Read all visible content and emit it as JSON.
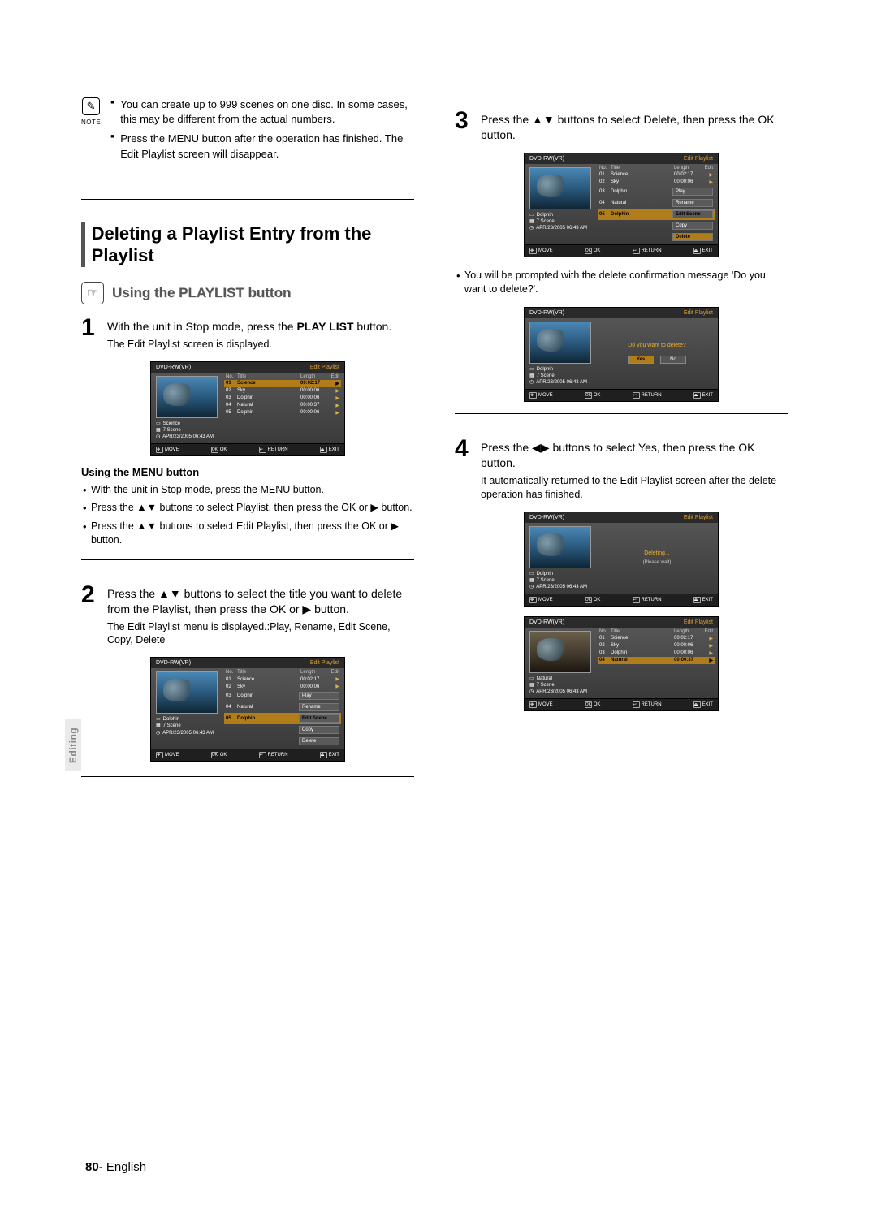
{
  "side_tab": "Editing",
  "page_number": "80",
  "page_lang": "English",
  "note": {
    "icon_glyph": "✎",
    "label": "NOTE",
    "items": [
      "You can create up to 999 scenes on one disc. In some cases, this may be different from the actual numbers.",
      "Press the MENU button after the operation has finished. The Edit Playlist screen will disappear."
    ]
  },
  "section_title": "Deleting a Playlist Entry from the Playlist",
  "subhead": "Using the PLAYLIST button",
  "steps": {
    "s1": {
      "num": "1",
      "main_a": "With the unit in Stop mode, press the ",
      "main_b": "PLAY LIST",
      "main_c": " button.",
      "sub": "The Edit Playlist screen is displayed."
    },
    "s2": {
      "num": "2",
      "main": "Press the ▲▼ buttons to select the title you want to delete from the Playlist, then press the OK or ▶ button.",
      "sub": "The Edit Playlist menu is displayed.:Play, Rename, Edit Scene, Copy, Delete"
    },
    "s3": {
      "num": "3",
      "main": "Press the ▲▼ buttons to select Delete, then press the OK button."
    },
    "s4": {
      "num": "4",
      "main": "Press the ◀▶ buttons to select Yes, then press the OK button.",
      "sub": "It automatically returned to the Edit Playlist screen after the delete operation has finished."
    }
  },
  "menu_alt": {
    "head": "Using the MENU button",
    "items": [
      "With the unit in Stop mode, press the MENU button.",
      "Press the ▲▼ buttons to select Playlist, then press the OK or ▶ button.",
      "Press the ▲▼ buttons to select Edit Playlist, then press the OK or ▶ button."
    ]
  },
  "confirm_bullet": "You will be prompted with the delete confirmation message 'Do you want to delete?'.",
  "osd_common": {
    "disc": "DVD-RW(VR)",
    "mode": "Edit Playlist",
    "cols": {
      "no": "No.",
      "title": "Title",
      "length": "Length",
      "edit": "Edit"
    },
    "foot": {
      "move": "MOVE",
      "ok": "OK",
      "return": "RETURN",
      "exit": "EXIT"
    },
    "scenes": "7 Scene",
    "timestamp": "APR/23/2005 06:43 AM"
  },
  "osd1": {
    "current": "Science",
    "rows": [
      {
        "no": "01",
        "title": "Science",
        "len": "00:02:17",
        "sel": true
      },
      {
        "no": "02",
        "title": "Sky",
        "len": "00:00:06"
      },
      {
        "no": "03",
        "title": "Dolphin",
        "len": "00:00:06"
      },
      {
        "no": "04",
        "title": "Natural",
        "len": "00:00:37"
      },
      {
        "no": "05",
        "title": "Dolphin",
        "len": "00:00:06"
      }
    ]
  },
  "osd2": {
    "current": "Dolphin",
    "rows": [
      {
        "no": "01",
        "title": "Science",
        "len": "00:02:17"
      },
      {
        "no": "02",
        "title": "Sky",
        "len": "00:00:06"
      },
      {
        "no": "03",
        "title": "Dolphin",
        "menu": "Play"
      },
      {
        "no": "04",
        "title": "Natural",
        "menu": "Rename"
      },
      {
        "no": "05",
        "title": "Dolphin",
        "menu": "Edit Scene",
        "sel": true
      }
    ],
    "extra_menu": [
      "Copy",
      "Delete"
    ]
  },
  "osd3": {
    "current": "Dolphin",
    "rows": [
      {
        "no": "01",
        "title": "Science",
        "len": "00:02:17"
      },
      {
        "no": "02",
        "title": "Sky",
        "len": "00:00:06"
      },
      {
        "no": "03",
        "title": "Dolphin",
        "menu": "Play"
      },
      {
        "no": "04",
        "title": "Natural",
        "menu": "Rename"
      },
      {
        "no": "05",
        "title": "Dolphin",
        "menu": "Edit Scene",
        "sel": true
      }
    ],
    "extra_menu": [
      "Copy",
      "Delete"
    ],
    "highlight_menu": "Delete"
  },
  "osd4": {
    "current": "Dolphin",
    "prompt": "Do you want to delete?",
    "yes": "Yes",
    "no": "No"
  },
  "osd5": {
    "current": "Dolphin",
    "line1": "Deleting...",
    "line2": "(Please wait)"
  },
  "osd6": {
    "current": "Natural",
    "rows": [
      {
        "no": "01",
        "title": "Science",
        "len": "00:02:17"
      },
      {
        "no": "02",
        "title": "Sky",
        "len": "00:00:06"
      },
      {
        "no": "03",
        "title": "Dolphin",
        "len": "00:00:06"
      },
      {
        "no": "04",
        "title": "Natural",
        "len": "00:00:37",
        "sel": true
      }
    ]
  }
}
